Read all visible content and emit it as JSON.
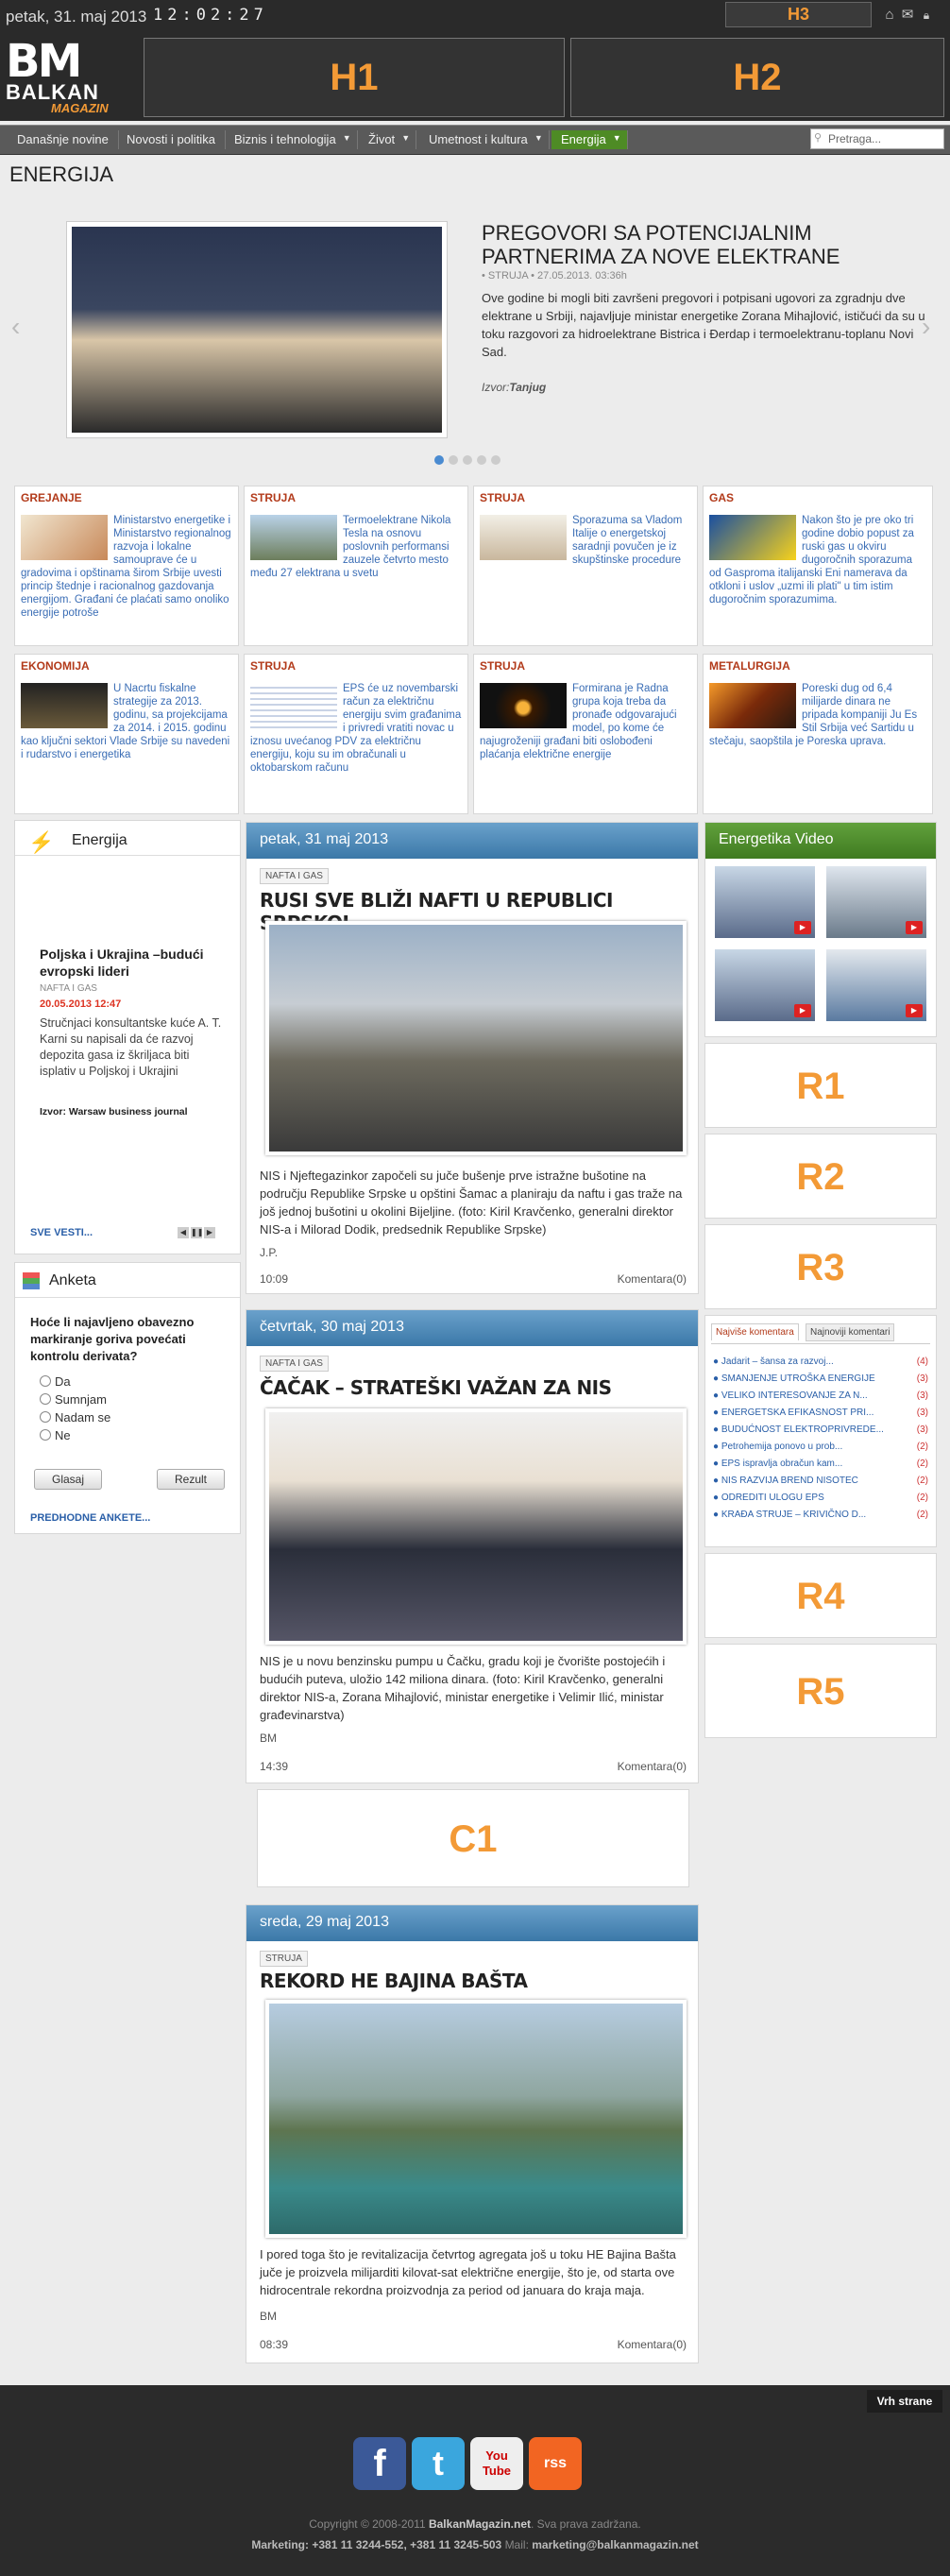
{
  "topbar": {
    "date": "petak, 31. maj 2013",
    "clock": "12:02:27",
    "h3_label": "H3"
  },
  "logo": {
    "bm": "BM",
    "balkan": "BALKAN",
    "magazin": "MAGAZIN"
  },
  "banners": {
    "h1": "H1",
    "h2": "H2"
  },
  "nav": {
    "items": [
      "Današnje novine",
      "Novosti i politika",
      "Biznis i tehnologija",
      "Život",
      "Umetnost i kultura",
      "Energija"
    ],
    "search_placeholder": "Pretraga..."
  },
  "section_title": "ENERGIJA",
  "slider": {
    "title": "PREGOVORI SA POTENCIJALNIM PARTNERIMA ZA NOVE ELEKTRANE",
    "meta": "• STRUJA • 27.05.2013. 03:36h",
    "text": "Ove godine bi mogli biti završeni pregovori i potpisani ugovori za zgradnju dve elektrane u Srbiji, najavljuje ministar energetike Zorana Mihajlović, ističući da su u toku razgovori za hidroelektrane Bistrica i Đerdap i termoelektranu-toplanu Novi Sad.",
    "source_label": "Izvor:",
    "source": "Tanjug"
  },
  "cards": [
    {
      "cat": "GREJANJE",
      "text": "Ministarstvo energetike i Ministarstvo regionalnog razvoja i lokalne samouprave će u gradovima i opštinama širom Srbije uvesti princip štednje i racionalnog gazdovanja energijom. Građani će plaćati samo onoliko energije potroše"
    },
    {
      "cat": "STRUJA",
      "text": "Termoelektrane Nikola Tesla na osnovu poslovnih performansi zauzele četvrto mesto među 27 elektrana u svetu"
    },
    {
      "cat": "STRUJA",
      "text": "Sporazuma sa Vladom Italije o energetskoj saradnji povučen je iz skupštinske procedure"
    },
    {
      "cat": "GAS",
      "text": "Nakon što je pre oko tri godine dobio popust za ruski gas u okviru dugoročnih sporazuma od Gasproma italijanski Eni namerava da otkloni i uslov „uzmi ili plati\" u tim istim dugoročnim sporazumima."
    },
    {
      "cat": "EKONOMIJA",
      "text": "U Nacrtu fiskalne strategije za 2013. godinu, sa projekcijama za 2014. i 2015. godinu kao ključni sektori Vlade Srbije su navedeni i rudarstvo i energetika"
    },
    {
      "cat": "STRUJA",
      "text": "EPS će uz novembarski račun za električnu energiju svim građanima i privredi vratiti novac u iznosu uvećanog PDV za električnu energiju, koju su im obračunali u oktobarskom računu"
    },
    {
      "cat": "STRUJA",
      "text": "Formirana je Radna grupa koja treba da pronađe odgovarajući model, po kome će najugroženiji građani biti oslobođeni plaćanja električne energije"
    },
    {
      "cat": "METALURGIJA",
      "text": "Poreski dug od 6,4 milijarde dinara ne pripada kompaniji Ju Es Stil Srbija već Sartidu u stečaju, saopštila je Poreska uprava."
    }
  ],
  "left_widget": {
    "title": "Energija",
    "news_title": "Poljska i Ukrajina –budući evropski lideri",
    "news_cat": "NAFTA I GAS",
    "news_date": "20.05.2013 12:47",
    "news_text": "Stručnjaci konsultantske kuće A. T. Karni su napisali da će razvoj depozita gasa iz škriljaca biti isplativ u Poljskoj i Ukrajini",
    "news_src": "Izvor: Warsaw business journal",
    "all_news": "SVE VESTI..."
  },
  "poll": {
    "title": "Anketa",
    "question": "Hoće li najavljeno obavezno markiranje goriva povećati kontrolu derivata?",
    "options": [
      "Da",
      "Sumnjam",
      "Nadam se",
      "Ne"
    ],
    "vote": "Glasaj",
    "results": "Rezult",
    "previous": "PREDHODNE ANKETE..."
  },
  "days": [
    {
      "date": "petak, 31 maj 2013",
      "tag": "NAFTA I GAS",
      "title": "RUSI SVE BLIŽI NAFTI U REPUBLICI SRPSKOJ",
      "text": "NIS i Njeftegazinkor započeli su juče bušenje prve istražne bušotine na području Republike Srpske u opštini Šamac a planiraju da naftu i gas traže na još jednoj bušotini u okolini Bijeljine. (foto: Kiril Kravčenko, generalni direktor NIS-a i Milorad Dodik, predsednik Republike Srpske)",
      "author": "J.P.",
      "time": "10:09",
      "comments": "Komentara(0)"
    },
    {
      "date": "četvrtak, 30 maj 2013",
      "tag": "NAFTA I GAS",
      "title": "ČAČAK – STRATEŠKI VAŽAN ZA NIS",
      "text": "NIS je u novu benzinsku pumpu u Čačku, gradu koji je čvorište postojećih i budućih puteva, uložio 142 miliona dinara. (foto: Kiril Kravčenko, generalni direktor NIS-a, Zorana Mihajlović, ministar energetike i Velimir Ilić, ministar građevinarstva)",
      "author": "BM",
      "time": "14:39",
      "comments": "Komentara(0)"
    },
    {
      "date": "sreda, 29 maj 2013",
      "tag": "STRUJA",
      "title": "REKORD HE BAJINA BAŠTA",
      "text": "I pored toga što je revitalizacija četvrtog agregata još u toku HE Bajina Bašta juče je proizvela milijarditi kilovat-sat električne energije, što je, od starta ove hidrocentrale rekordna proizvodnja za period od januara do kraja maja.",
      "author": "BM",
      "time": "08:39",
      "comments": "Komentara(0)"
    }
  ],
  "c1_label": "C1",
  "video": {
    "title": "Energetika Video"
  },
  "right_labels": {
    "r1": "R1",
    "r2": "R2",
    "r3": "R3",
    "r4": "R4",
    "r5": "R5"
  },
  "comments_box": {
    "tab_active": "Najviše komentara",
    "tab_other": "Najnoviji komentari",
    "items": [
      {
        "title": "Jadarit – šansa za razvoj...",
        "count": "(4)"
      },
      {
        "title": "SMANJENJE UTROŠKA ENERGIJE",
        "count": "(3)"
      },
      {
        "title": "VELIKO INTERESOVANJE ZA N...",
        "count": "(3)"
      },
      {
        "title": "ENERGETSKA EFIKASNOST PRI...",
        "count": "(3)"
      },
      {
        "title": "BUDUĆNOST ELEKTROPRIVREDE...",
        "count": "(3)"
      },
      {
        "title": "Petrohemija ponovo u prob...",
        "count": "(2)"
      },
      {
        "title": "EPS ispravlja obračun kam...",
        "count": "(2)"
      },
      {
        "title": "NIS RAZVIJA BREND NISOTEC",
        "count": "(2)"
      },
      {
        "title": "ODREDITI ULOGU EPS",
        "count": "(2)"
      },
      {
        "title": "KRAĐA STRUJE – KRIVIČNO D...",
        "count": "(2)"
      }
    ]
  },
  "back_to_top": "Vrh strane",
  "social": [
    "f",
    "t",
    "You Tube",
    "rss"
  ],
  "footer": {
    "copyright_pre": "Copyright © 2008-2011 ",
    "site": "BalkanMagazin.net",
    "copyright_post": ". Sva prava zadržana.",
    "marketing_label": "Marketing:",
    "phones": "+381 11 3244-552, +381 11 3245-503",
    "mail_label": "Mail:",
    "mail": "marketing@balkanmagazin.net"
  },
  "colors": {
    "accent_orange": "#f39a36",
    "nav_green": "#4e8b25",
    "head_blue": "#4a86b5",
    "category_red": "#b23a1a"
  }
}
